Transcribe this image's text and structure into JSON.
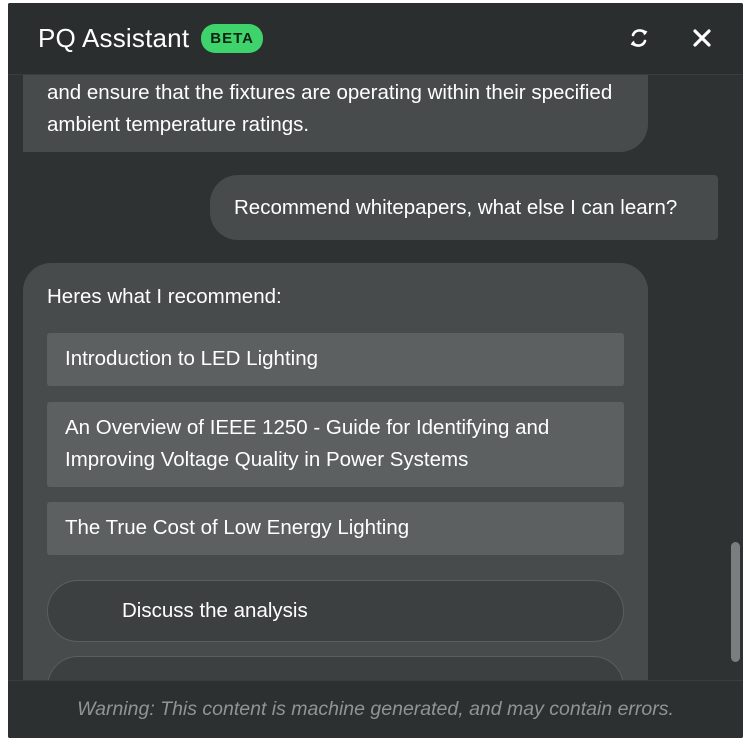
{
  "header": {
    "title": "PQ Assistant",
    "badge": "BETA",
    "refresh_icon": "refresh-icon",
    "close_icon": "close-icon"
  },
  "messages": {
    "assistant_prev_text": "and ensure that the fixtures are operating within their specified ambient temperature ratings.",
    "user_text": "Recommend whitepapers, what else I can learn?",
    "assistant_intro": "Heres what I recommend:",
    "recommendations": [
      "Introduction to LED Lighting",
      "An Overview of IEEE 1250 - Guide for Identifying and Improving Voltage Quality in Power Systems",
      "The True Cost of Low Energy Lighting"
    ],
    "suggestions": [
      "Discuss the analysis"
    ]
  },
  "footer": {
    "warning": "Warning: This content is machine generated, and may contain errors."
  },
  "colors": {
    "panel_bg": "#2f3232",
    "bubble_bg": "#474b4b",
    "card_bg": "#5c6060",
    "beta_badge": "#3fd36b"
  }
}
